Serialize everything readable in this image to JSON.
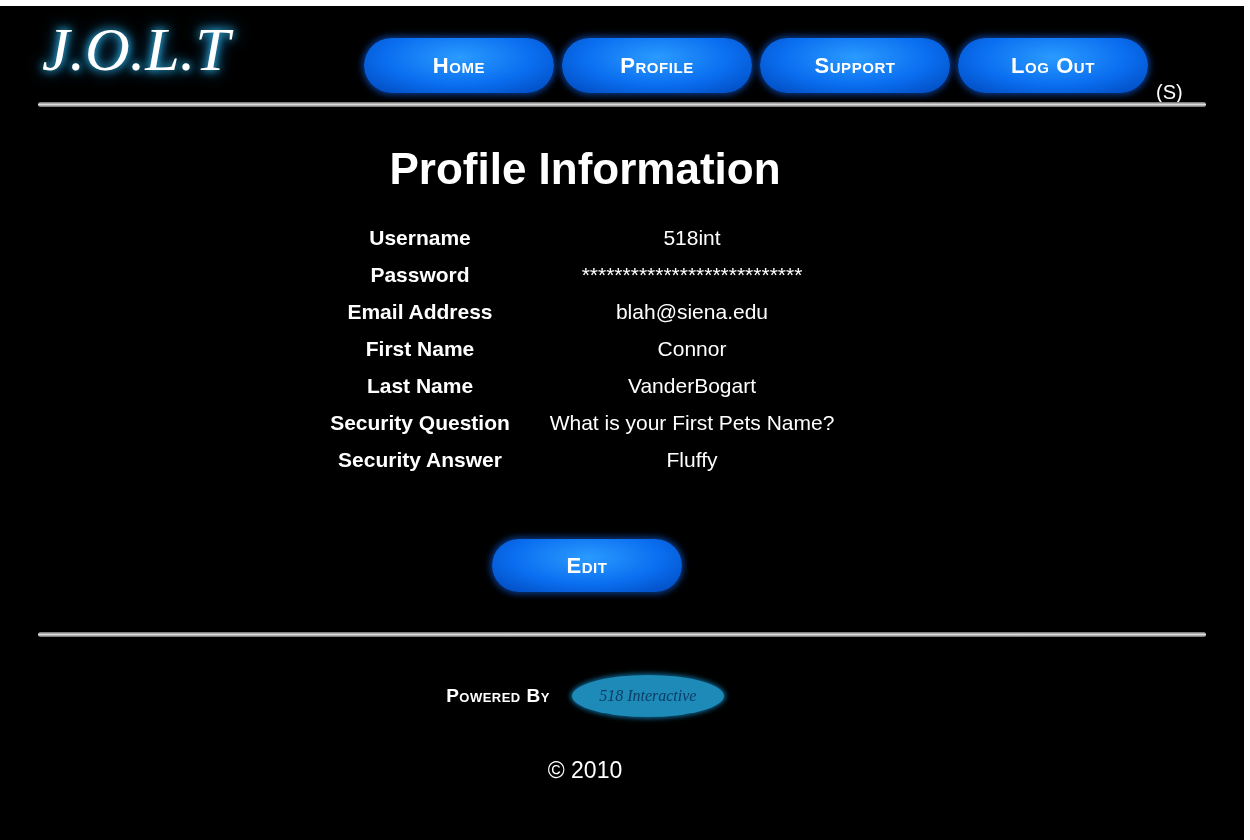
{
  "header": {
    "logo": "J.O.L.T",
    "nav": [
      {
        "label": "Home"
      },
      {
        "label": "Profile"
      },
      {
        "label": "Support"
      },
      {
        "label": "Log Out"
      }
    ],
    "suffix": "(S)"
  },
  "title": "Profile Information",
  "fields": [
    {
      "label": "Username",
      "value": "518int"
    },
    {
      "label": "Password",
      "value": "***************************"
    },
    {
      "label": "Email Address",
      "value": "blah@siena.edu"
    },
    {
      "label": "First Name",
      "value": "Connor"
    },
    {
      "label": "Last Name",
      "value": "VanderBogart"
    },
    {
      "label": "Security Question",
      "value": "What is your First Pets Name?"
    },
    {
      "label": "Security Answer",
      "value": "Fluffy"
    }
  ],
  "edit_button": "Edit",
  "footer": {
    "powered_by": "Powered By",
    "partner_logo": "518 Interactive",
    "copyright": "© 2010"
  }
}
